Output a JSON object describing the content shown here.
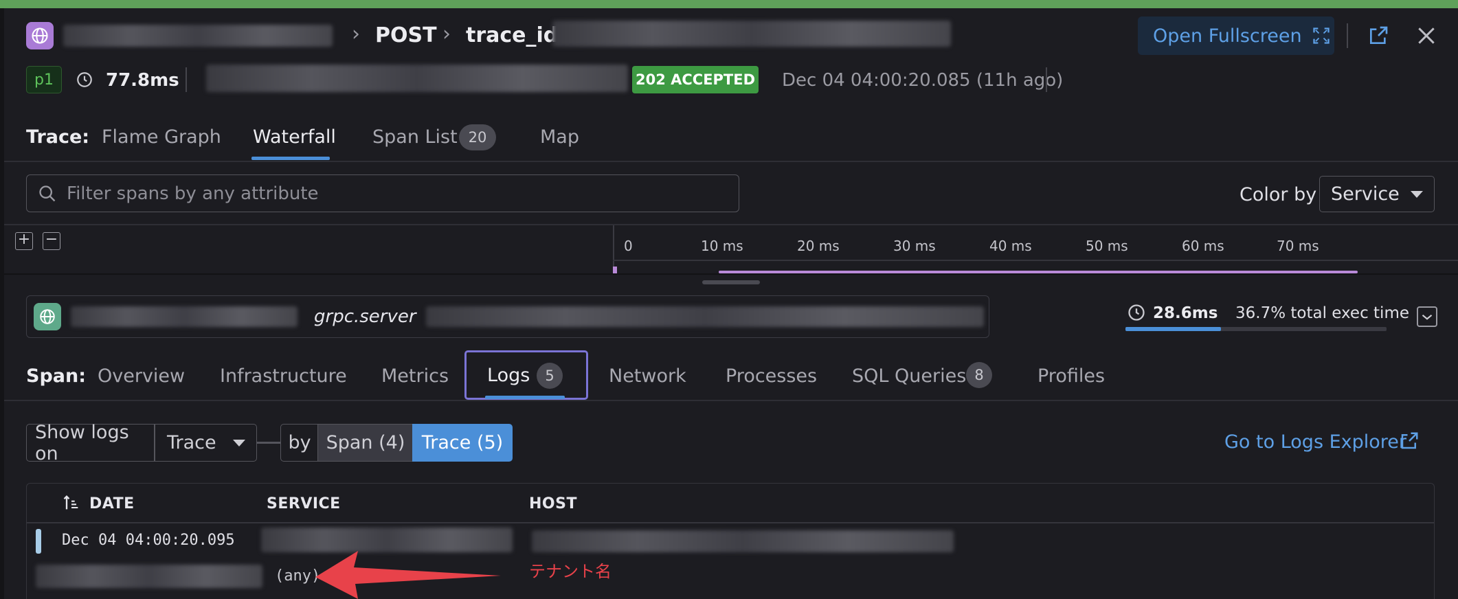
{
  "header": {
    "breadcrumb_method": "POST",
    "breadcrumb_trace": "trace_id",
    "open_fullscreen_label": "Open Fullscreen",
    "priority": "p1",
    "duration": "77.8ms",
    "status": "202 ACCEPTED",
    "timestamp": "Dec 04 04:00:20.085 (11h ago)"
  },
  "trace_tabs": {
    "label": "Trace:",
    "items": [
      {
        "label": "Flame Graph"
      },
      {
        "label": "Waterfall"
      },
      {
        "label": "Span List",
        "count": "20"
      },
      {
        "label": "Map"
      }
    ],
    "active": "Waterfall"
  },
  "filter": {
    "placeholder": "Filter spans by any attribute",
    "color_by_label": "Color by",
    "color_by_value": "Service"
  },
  "timeline": {
    "ticks": [
      "0",
      "10 ms",
      "20 ms",
      "30 ms",
      "40 ms",
      "50 ms",
      "60 ms",
      "70 ms"
    ]
  },
  "span": {
    "operation": "grpc.server",
    "duration": "28.6ms",
    "exec_time": "36.7% total exec time",
    "exec_fraction": 0.367
  },
  "span_tabs": {
    "label": "Span:",
    "items": [
      {
        "label": "Overview"
      },
      {
        "label": "Infrastructure"
      },
      {
        "label": "Metrics"
      },
      {
        "label": "Logs",
        "count": "5"
      },
      {
        "label": "Network"
      },
      {
        "label": "Processes"
      },
      {
        "label": "SQL Queries",
        "count": "8"
      },
      {
        "label": "Profiles"
      }
    ],
    "active": "Logs"
  },
  "logs_controls": {
    "show_logs_on_label": "Show logs on",
    "show_logs_on_value": "Trace",
    "by_label": "by",
    "span_option": "Span (4)",
    "trace_option": "Trace (5)",
    "explorer_link": "Go to Logs Explorer"
  },
  "logs_table": {
    "columns": [
      "DATE",
      "SERVICE",
      "HOST"
    ],
    "rows": [
      {
        "date": "Dec 04 04:00:20.095",
        "detail": "(any)"
      }
    ]
  },
  "annotation": {
    "text": "テナント名",
    "color": "#e8424a"
  },
  "colors": {
    "accent": "#4b8fd8",
    "status_ok": "#3d9a42",
    "top_bar": "#5fa15a"
  }
}
